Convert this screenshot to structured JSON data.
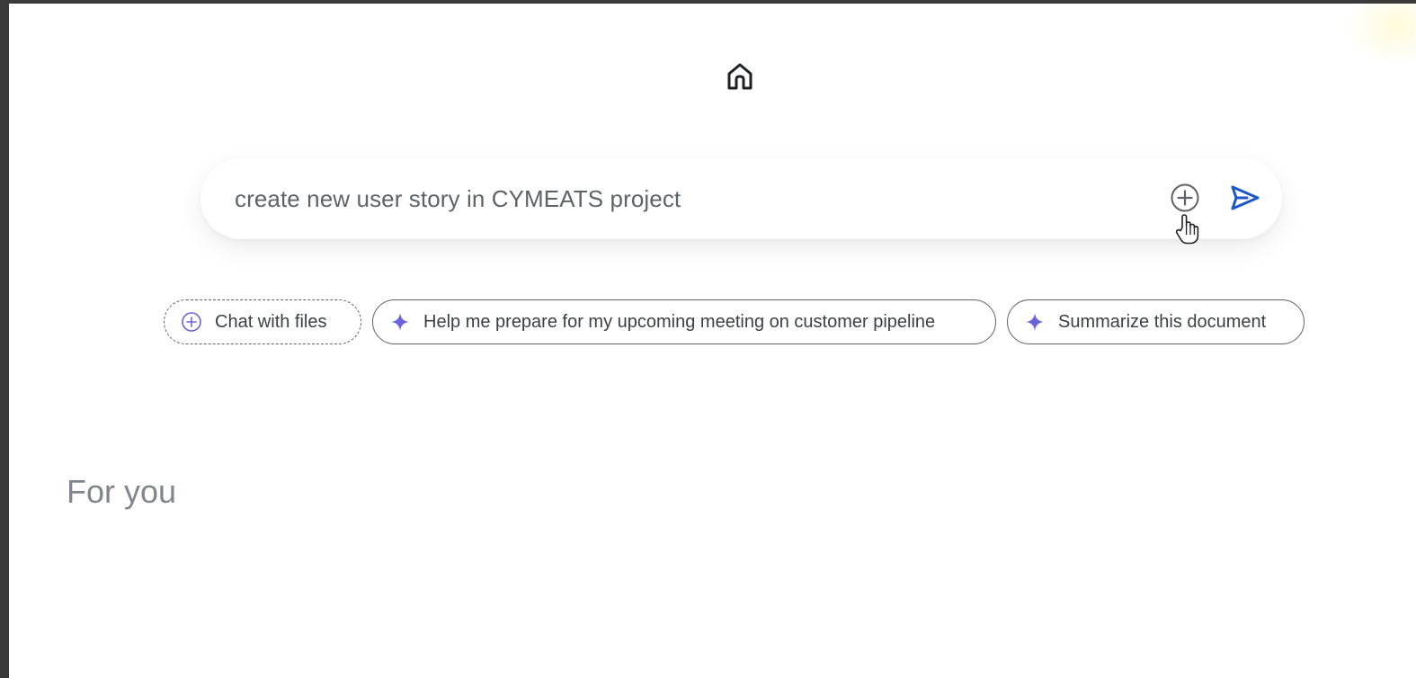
{
  "header": {
    "icon": "home-icon"
  },
  "search": {
    "value": "create new user story in CYMEATS project",
    "add_icon": "add-circle-icon",
    "send_icon": "send-icon"
  },
  "chips": [
    {
      "label": "Chat with files",
      "icon": "add-circle-icon",
      "style": "dashed"
    },
    {
      "label": "Help me prepare for my upcoming meeting on customer pipeline",
      "icon": "sparkle-icon",
      "style": "solid"
    },
    {
      "label": "Summarize this document",
      "icon": "sparkle-icon",
      "style": "solid"
    }
  ],
  "section": {
    "title": "For you"
  },
  "colors": {
    "accent": "#1a57c8",
    "sparkle": "#6b63d9",
    "chip_border": "#5f6368",
    "muted_text": "#80868b"
  }
}
